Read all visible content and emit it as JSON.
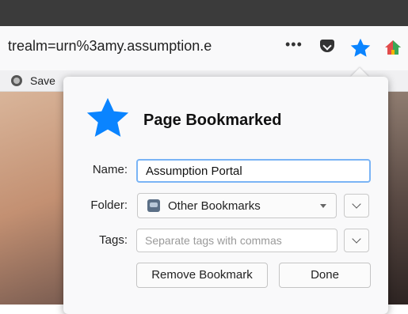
{
  "toolbar": {
    "url_text": "trealm=urn%3amy.assumption.e",
    "more_label": "•••",
    "bookmark_save_label": "Save",
    "star_color": "#0a84ff"
  },
  "panel": {
    "title": "Page Bookmarked",
    "name_label": "Name:",
    "name_value": "Assumption Portal",
    "folder_label": "Folder:",
    "folder_value": "Other Bookmarks",
    "tags_label": "Tags:",
    "tags_placeholder": "Separate tags with commas",
    "remove_button": "Remove Bookmark",
    "done_button": "Done"
  },
  "icons": [
    "more-icon",
    "pocket-icon",
    "star-icon",
    "home-icon",
    "save-icon",
    "folder-icon",
    "chevron-down-icon"
  ]
}
